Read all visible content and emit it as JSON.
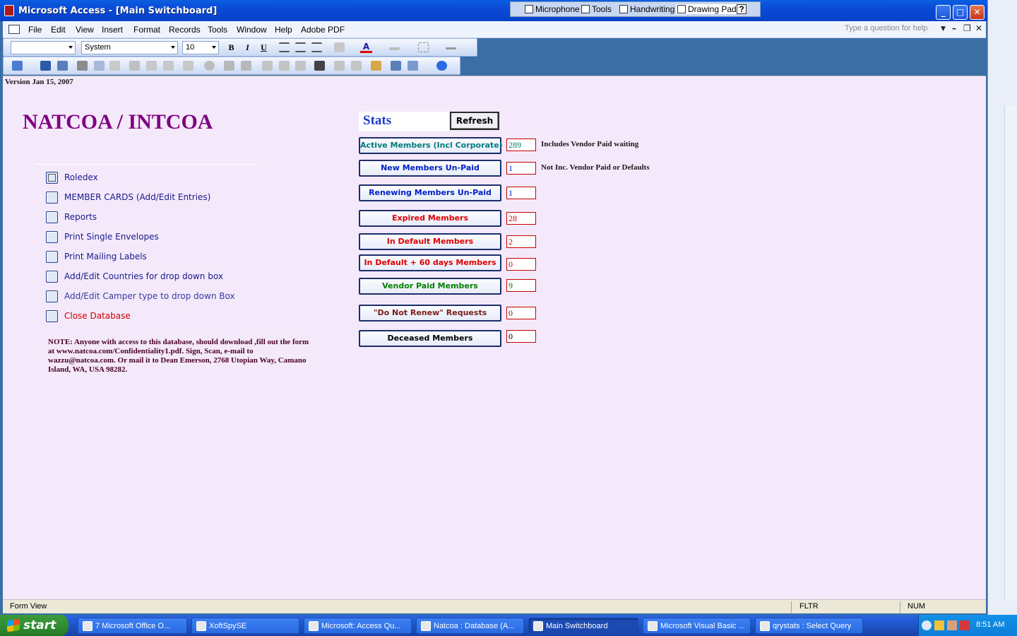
{
  "window": {
    "title": "Microsoft Access - [Main Switchboard]",
    "language_bar": {
      "microphone": "Microphone",
      "tools": "Tools",
      "handwriting": "Handwriting",
      "drawing_pad": "Drawing Pad",
      "help_glyph": "?"
    }
  },
  "menubar": {
    "items": [
      "File",
      "Edit",
      "View",
      "Insert",
      "Format",
      "Records",
      "Tools",
      "Window",
      "Help",
      "Adobe PDF"
    ],
    "help_placeholder": "Type a question for help"
  },
  "formatting_toolbar": {
    "object_combo": "",
    "font": "System",
    "size": "10",
    "bold": "B",
    "italic": "I",
    "underline": "U",
    "font_color_glyph": "A"
  },
  "form": {
    "version": "Version Jan 15, 2007",
    "title": "NATCOA / INTCOA",
    "options": [
      {
        "label": "Roledex",
        "color": "#1a1a8a"
      },
      {
        "label": "MEMBER CARDS (Add/Edit Entries)",
        "color": "#1a1a8a"
      },
      {
        "label": "Reports",
        "color": "#1a1a8a"
      },
      {
        "label": "Print Single Envelopes",
        "color": "#1a1a8a"
      },
      {
        "label": "Print Mailing Labels",
        "color": "#1a1a8a"
      },
      {
        "label": "Add/Edit Countries for drop down box",
        "color": "#1a1a8a"
      },
      {
        "label": "Add/Edit Camper type to drop down Box",
        "color": "#3a3aa0"
      },
      {
        "label": "Close Database",
        "color": "#d00000"
      }
    ],
    "note": "NOTE: Anyone with access to this database, should download ,fill out the form at www.natcoa.com/Confidentiality1.pdf. Sign, Scan,  e-mail to wazzu@natcoa.com. Or mail it to Dean Emerson, 2768 Utopian Way, Camano Island, WA, USA 98282.",
    "stats": {
      "label": "Stats",
      "refresh": "Refresh",
      "rows": [
        {
          "button": "Active Members (Incl Corporate)",
          "value": "289",
          "note": "Includes Vendor Paid waiting",
          "color": "#007c7c"
        },
        {
          "button": "New  Members Un-Paid",
          "value": "1",
          "note": "Not Inc. Vendor Paid or Defaults",
          "color": "#0020c8"
        },
        {
          "button": "Renewing Members Un-Paid",
          "value": "1",
          "note": "",
          "color": "#0020c8"
        },
        {
          "button": "Expired Members",
          "value": "28",
          "note": "",
          "color": "#e00000"
        },
        {
          "button": "In Default Members",
          "value": "2",
          "note": "",
          "color": "#e00000"
        },
        {
          "button": "In Default + 60 days  Members",
          "value": "0",
          "note": "",
          "color": "#e00000"
        },
        {
          "button": "Vendor Paid Members",
          "value": "9",
          "note": "",
          "color": "#008000"
        },
        {
          "button": "\"Do Not Renew\"  Requests",
          "value": "0",
          "note": "",
          "color": "#7a1a1a"
        },
        {
          "button": "Deceased Members",
          "value": "0",
          "note": "",
          "color": "#000000"
        }
      ]
    }
  },
  "statusbar": {
    "view": "Form View",
    "fltr": "FLTR",
    "num": "NUM"
  },
  "taskbar": {
    "start": "start",
    "tasks": [
      "7 Microsoft Office O...",
      "XoftSpySE",
      "Microsoft: Access Qu...",
      "Natcoa : Database (A...",
      "Main Switchboard",
      "Microsoft Visual Basic ...",
      "qrystats : Select Query"
    ],
    "clock": "8:51 AM"
  }
}
